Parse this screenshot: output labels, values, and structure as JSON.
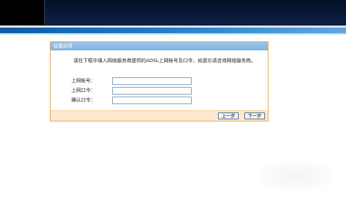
{
  "wizard": {
    "title": "设置向导",
    "intro": "请在下框中填入网络服务商提供的ADSL上网帐号及口令，如遗忘请咨询网络服务商。",
    "fields": [
      {
        "label": "上网帐号：",
        "value": ""
      },
      {
        "label": "上网口令：",
        "value": ""
      },
      {
        "label": "确认口令：",
        "value": ""
      }
    ],
    "buttons": {
      "prev": "上一步",
      "next": "下一步"
    }
  }
}
